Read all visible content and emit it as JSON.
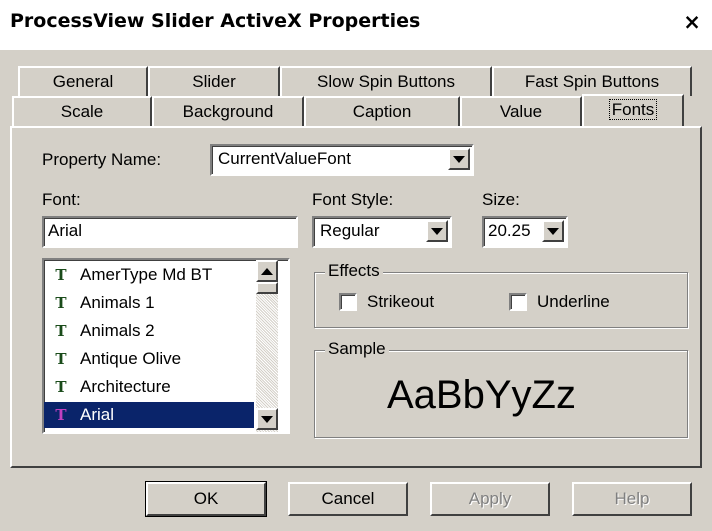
{
  "window": {
    "title": "ProcessView Slider ActiveX Properties",
    "close_label": "×"
  },
  "tabs": {
    "row1": [
      "General",
      "Slider",
      "Slow Spin Buttons",
      "Fast Spin Buttons"
    ],
    "row2": [
      "Scale",
      "Background",
      "Caption",
      "Value",
      "Fonts"
    ],
    "selected": "Fonts"
  },
  "fonts_page": {
    "property_name_label": "Property Name:",
    "property_name_value": "CurrentValueFont",
    "font_label": "Font:",
    "font_value": "Arial",
    "font_list": [
      "AmerType Md BT",
      "Animals 1",
      "Animals 2",
      "Antique Olive",
      "Architecture",
      "Arial"
    ],
    "font_list_selected": "Arial",
    "font_style_label": "Font Style:",
    "font_style_value": "Regular",
    "size_label": "Size:",
    "size_value": "20.25",
    "effects_label": "Effects",
    "strikeout_label": "Strikeout",
    "strikeout_checked": false,
    "underline_label": "Underline",
    "underline_checked": false,
    "sample_label": "Sample",
    "sample_text": "AaBbYyZz"
  },
  "buttons": {
    "ok": "OK",
    "cancel": "Cancel",
    "apply": "Apply",
    "help": "Help"
  },
  "icons": {
    "truetype": "truetype-font-icon",
    "close": "close-icon"
  },
  "colors": {
    "face": "#d4d0c8",
    "selection": "#0a246a",
    "truetype_icon": "#1a4b1a"
  }
}
